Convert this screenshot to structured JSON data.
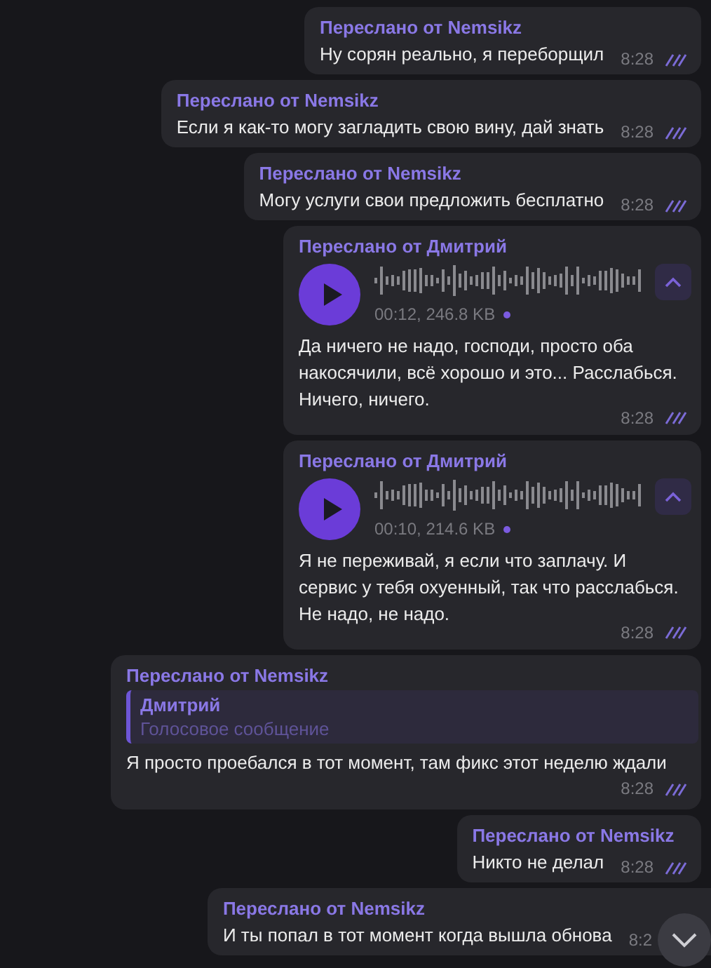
{
  "messages": [
    {
      "kind": "text",
      "header": "Переслано от Nemsikz",
      "text": "Ну сорян реально, я переборщил",
      "time": "8:28",
      "read": true
    },
    {
      "kind": "text",
      "header": "Переслано от Nemsikz",
      "text": "Если я как-то могу загладить свою вину, дай знать",
      "time": "8:28",
      "read": true
    },
    {
      "kind": "text",
      "header": "Переслано от Nemsikz",
      "text": "Могу услуги свои предложить бесплатно",
      "time": "8:28",
      "read": true
    },
    {
      "kind": "voice",
      "header": "Переслано от Дмитрий",
      "duration": "00:12, 246.8 KB",
      "unplayed": true,
      "text": "Да ничего не надо, господи, просто оба накосячили, всё хорошо и это... Расслабься. Ничего, ничего.",
      "time": "8:28",
      "read": true
    },
    {
      "kind": "voice",
      "header": "Переслано от Дмитрий",
      "duration": "00:10, 214.6 KB",
      "unplayed": true,
      "text": "Я не переживай, я если что заплачу. И сервис у тебя охуенный, так что расслабься. Не надо, не надо.",
      "time": "8:28",
      "read": true
    },
    {
      "kind": "reply",
      "header": "Переслано от Nemsikz",
      "quote_name": "Дмитрий",
      "quote_text": "Голосовое сообщение",
      "text": "Я просто проебался в тот момент, там фикс этот неделю ждали",
      "time": "8:28",
      "read": true
    },
    {
      "kind": "text",
      "header": "Переслано от Nemsikz",
      "text": "Никто не делал",
      "time": "8:28",
      "read": true
    },
    {
      "kind": "text",
      "header": "Переслано от Nemsikz",
      "text": "И ты попал в тот момент когда вышла обнова",
      "time": "8:2",
      "read": false
    }
  ]
}
